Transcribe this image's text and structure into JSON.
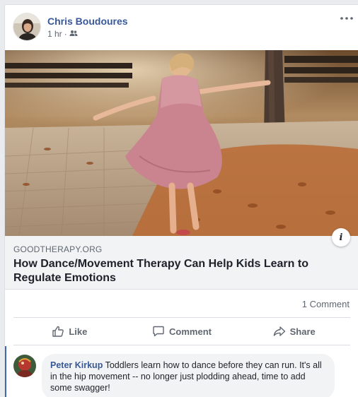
{
  "post": {
    "author": "Chris Boudoures",
    "time": "1 hr",
    "separator": "·",
    "audience_icon": "friends-icon",
    "more_icon": "more-dots-icon"
  },
  "link_preview": {
    "domain": "GOODTHERAPY.ORG",
    "title": "How Dance/Movement Therapy Can Help Kids Learn to Regulate Emotions",
    "info_label": "i"
  },
  "stats": {
    "comments": "1 Comment"
  },
  "actions": {
    "like": "Like",
    "comment": "Comment",
    "share": "Share"
  },
  "comment": {
    "author": "Peter Kirkup",
    "text": "Toddlers learn how to dance before they can run. It's all in the hip movement -- no longer just plodding ahead, time to add some swagger!"
  },
  "colors": {
    "link_blue": "#385898",
    "accent": "#4267b2",
    "muted": "#606770"
  }
}
